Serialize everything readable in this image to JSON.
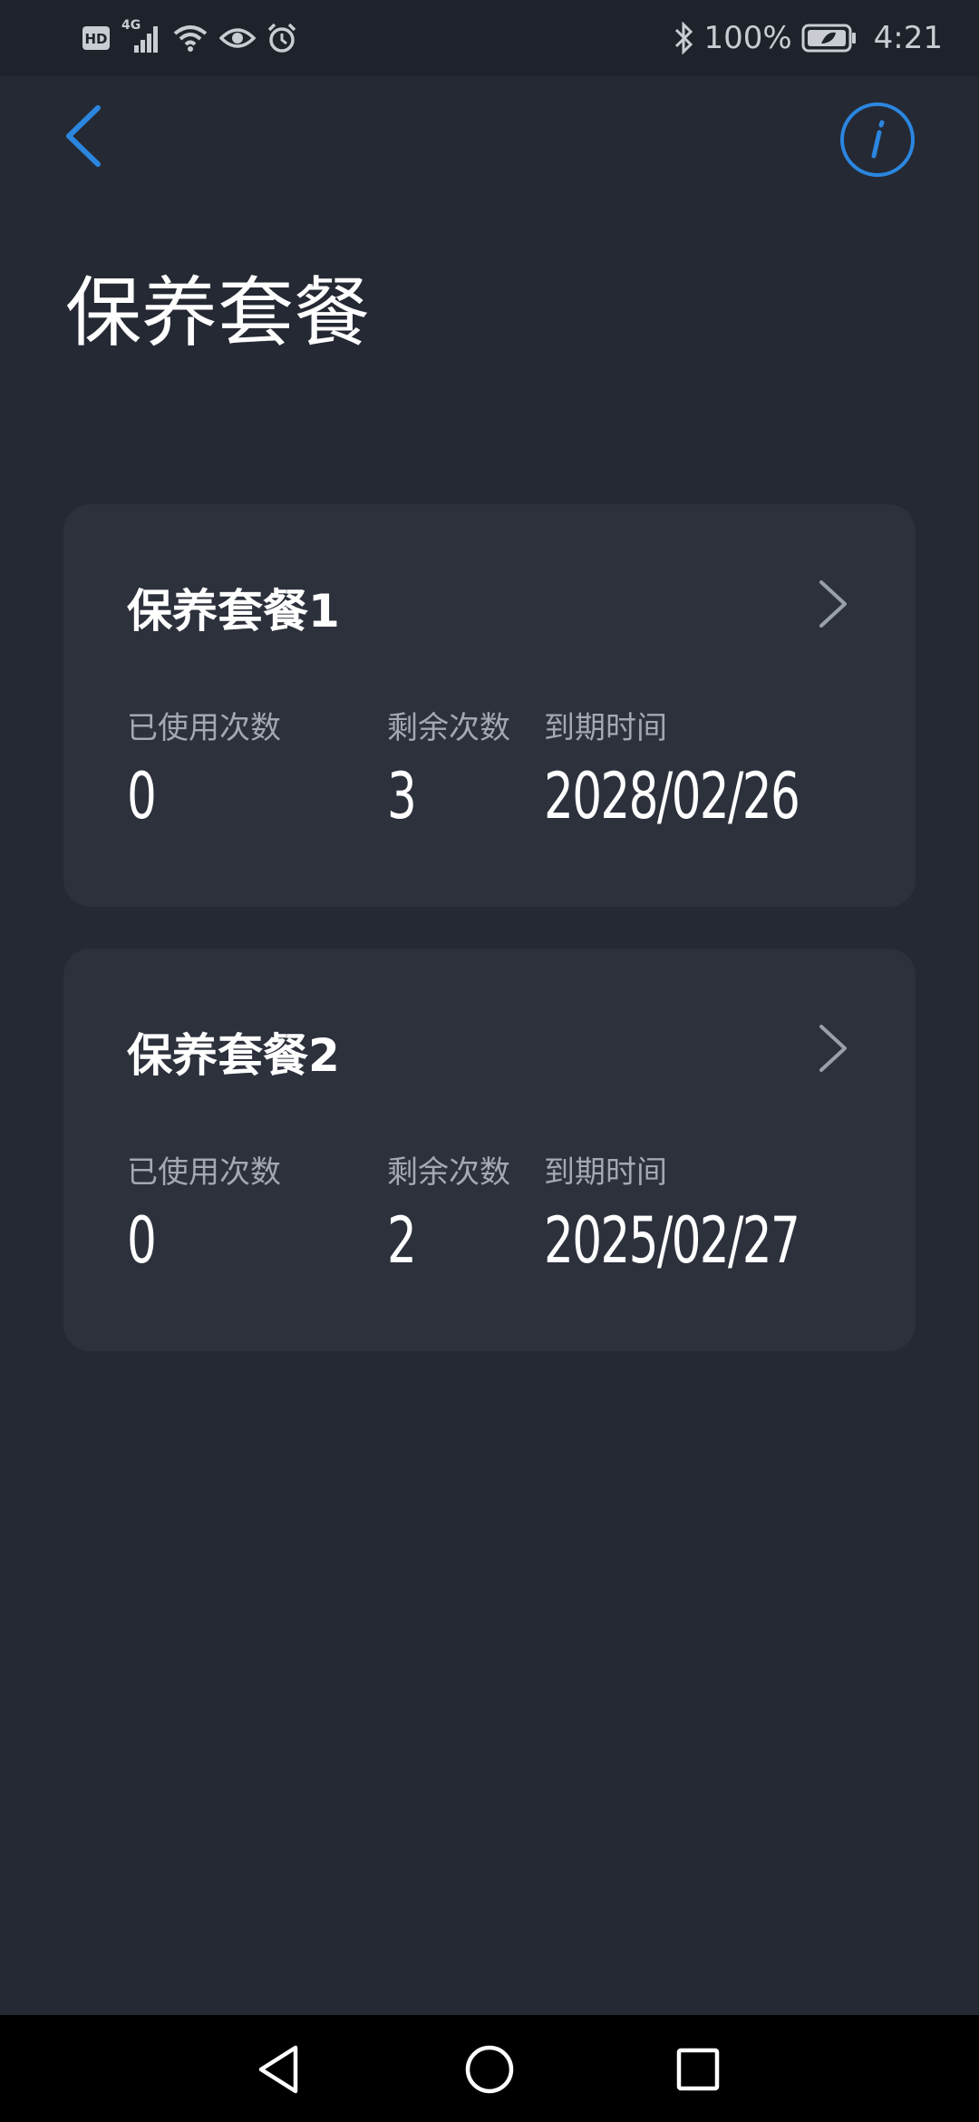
{
  "status_bar": {
    "left_icons": [
      "hd-icon",
      "signal-4g-icon",
      "wifi-icon",
      "eye-icon",
      "alarm-icon"
    ],
    "network_label": "4G",
    "battery_percent": "100%",
    "time": "4:21"
  },
  "header": {
    "title": "保养套餐"
  },
  "colors": {
    "accent": "#2b86e0",
    "background": "#252933",
    "card": "#2c313c"
  },
  "packages": [
    {
      "name": "保养套餐1",
      "used_label": "已使用次数",
      "used_value": "0",
      "remaining_label": "剩余次数",
      "remaining_value": "3",
      "expiry_label": "到期时间",
      "expiry_value": "2028/02/26"
    },
    {
      "name": "保养套餐2",
      "used_label": "已使用次数",
      "used_value": "0",
      "remaining_label": "剩余次数",
      "remaining_value": "2",
      "expiry_label": "到期时间",
      "expiry_value": "2025/02/27"
    }
  ],
  "nav_bar": {
    "buttons": [
      "back-triangle-icon",
      "home-circle-icon",
      "recents-square-icon"
    ]
  }
}
